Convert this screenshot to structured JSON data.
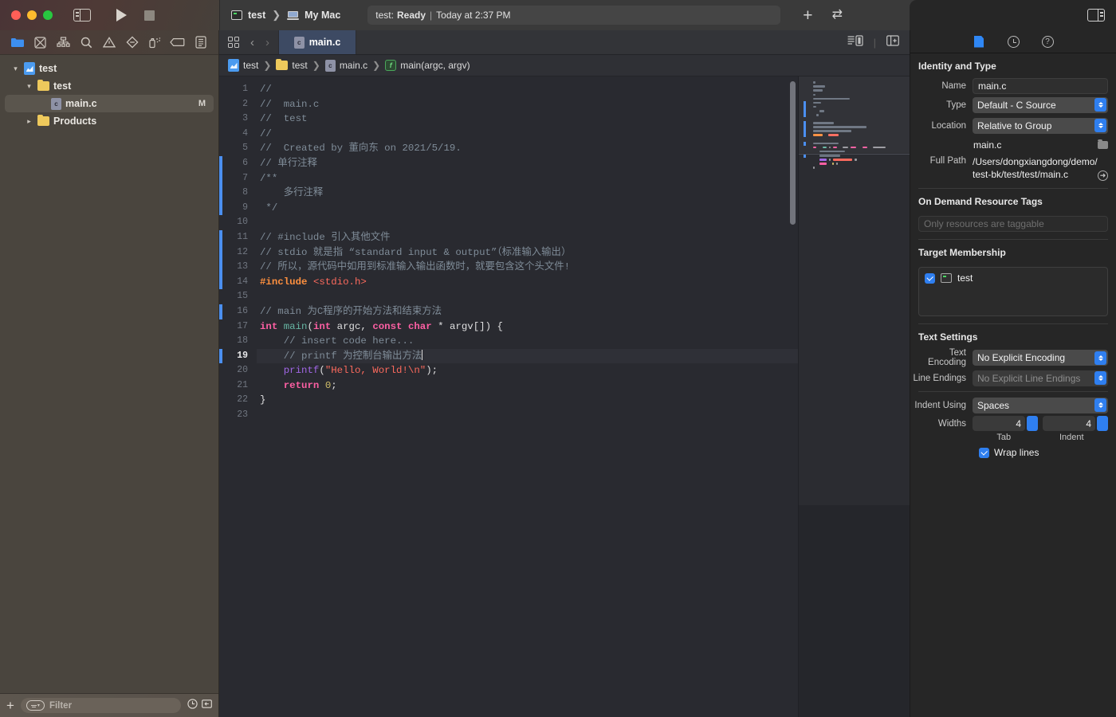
{
  "window": {
    "traffic_lights": [
      "close",
      "minimize",
      "zoom"
    ]
  },
  "toolbar": {
    "sidebar_toggle_name": "sidebar-toggle-icon",
    "run_label": "run-icon",
    "stop_label": "stop-icon",
    "scheme_name": "test",
    "destination": "My Mac",
    "activity_prefix": "test:",
    "activity_status": "Ready",
    "activity_separator": "|",
    "activity_time": "Today at 2:37 PM",
    "add_label": "+",
    "swap_label": "⇄",
    "inspector_toggle_name": "inspector-toggle-icon"
  },
  "navigator": {
    "tabs": [
      {
        "name": "project-navigator-tab",
        "icon": "folder-icon",
        "active": true
      },
      {
        "name": "source-control-navigator-tab",
        "icon": "source-control-icon",
        "active": false
      },
      {
        "name": "hierarchy-navigator-tab",
        "icon": "hierarchy-icon",
        "active": false
      },
      {
        "name": "find-navigator-tab",
        "icon": "search-icon",
        "active": false
      },
      {
        "name": "issue-navigator-tab",
        "icon": "warning-triangle-icon",
        "active": false
      },
      {
        "name": "test-navigator-tab",
        "icon": "diamond-icon",
        "active": false
      },
      {
        "name": "debug-navigator-tab",
        "icon": "spray-icon",
        "active": false
      },
      {
        "name": "breakpoint-navigator-tab",
        "icon": "tag-icon",
        "active": false
      },
      {
        "name": "report-navigator-tab",
        "icon": "report-icon",
        "active": false
      }
    ],
    "tree": [
      {
        "label": "test",
        "icon": "xcode-project-icon",
        "indent": 0,
        "disclosure": "open",
        "badge": "",
        "selected": false
      },
      {
        "label": "test",
        "icon": "folder-icon",
        "indent": 1,
        "disclosure": "open",
        "badge": "",
        "selected": false
      },
      {
        "label": "main.c",
        "icon": "c-file-icon",
        "indent": 2,
        "disclosure": "none",
        "badge": "M",
        "selected": true
      },
      {
        "label": "Products",
        "icon": "folder-icon",
        "indent": 1,
        "disclosure": "closed",
        "badge": "",
        "selected": false
      }
    ],
    "filter": {
      "add_label": "+",
      "placeholder": "Filter",
      "recent_icon": "clock-icon",
      "collapse_icon": "collapse-icon"
    }
  },
  "editor": {
    "tabbar": {
      "grid_icon": "tab-overview-icon",
      "back_label": "‹",
      "forward_label": "›",
      "tab_label": "main.c",
      "right_icons": [
        "editor-options-icon",
        "add-editor-icon"
      ]
    },
    "breadcrumb": [
      {
        "label": "test",
        "icon": "xcode-project-icon"
      },
      {
        "label": "test",
        "icon": "folder-icon"
      },
      {
        "label": "main.c",
        "icon": "c-file-icon"
      },
      {
        "label": "main(argc, argv)",
        "icon": "function-icon"
      }
    ],
    "current_line": 19,
    "changed_line_ranges": [
      [
        6,
        9
      ],
      [
        11,
        14
      ],
      [
        16,
        16
      ],
      [
        19,
        19
      ]
    ],
    "lines": [
      {
        "n": 1,
        "tokens": [
          {
            "t": "//",
            "c": "cmt"
          }
        ]
      },
      {
        "n": 2,
        "tokens": [
          {
            "t": "//  main.c",
            "c": "cmt"
          }
        ]
      },
      {
        "n": 3,
        "tokens": [
          {
            "t": "//  test",
            "c": "cmt"
          }
        ]
      },
      {
        "n": 4,
        "tokens": [
          {
            "t": "//",
            "c": "cmt"
          }
        ]
      },
      {
        "n": 5,
        "tokens": [
          {
            "t": "//  Created by 董向东 on 2021/5/19.",
            "c": "cmt"
          }
        ]
      },
      {
        "n": 6,
        "tokens": [
          {
            "t": "// 单行注释",
            "c": "cmt"
          }
        ]
      },
      {
        "n": 7,
        "tokens": [
          {
            "t": "/**",
            "c": "cmt"
          }
        ]
      },
      {
        "n": 8,
        "tokens": [
          {
            "t": "    多行注释",
            "c": "cmt"
          }
        ]
      },
      {
        "n": 9,
        "tokens": [
          {
            "t": " */",
            "c": "cmt"
          }
        ]
      },
      {
        "n": 10,
        "tokens": []
      },
      {
        "n": 11,
        "tokens": [
          {
            "t": "// #include 引入其他文件",
            "c": "cmt"
          }
        ]
      },
      {
        "n": 12,
        "tokens": [
          {
            "t": "// stdio 就是指 “standard input & output”（标准输入输出）",
            "c": "cmt"
          }
        ]
      },
      {
        "n": 13,
        "tokens": [
          {
            "t": "// 所以，源代码中如用到标准输入输出函数时，就要包含这个头文件!",
            "c": "cmt"
          }
        ]
      },
      {
        "n": 14,
        "tokens": [
          {
            "t": "#include",
            "c": "pp"
          },
          {
            "t": " ",
            "c": "plain"
          },
          {
            "t": "<stdio.h>",
            "c": "str"
          }
        ]
      },
      {
        "n": 15,
        "tokens": []
      },
      {
        "n": 16,
        "tokens": [
          {
            "t": "// main 为C程序的开始方法和结束方法",
            "c": "cmt"
          }
        ]
      },
      {
        "n": 17,
        "tokens": [
          {
            "t": "int",
            "c": "kw"
          },
          {
            "t": " ",
            "c": "plain"
          },
          {
            "t": "main",
            "c": "fn"
          },
          {
            "t": "(",
            "c": "plain"
          },
          {
            "t": "int",
            "c": "kw"
          },
          {
            "t": " argc, ",
            "c": "plain"
          },
          {
            "t": "const",
            "c": "kw"
          },
          {
            "t": " ",
            "c": "plain"
          },
          {
            "t": "char",
            "c": "kw"
          },
          {
            "t": " * argv[]) {",
            "c": "plain"
          }
        ]
      },
      {
        "n": 18,
        "tokens": [
          {
            "t": "    // insert code here...",
            "c": "cmt"
          }
        ]
      },
      {
        "n": 19,
        "tokens": [
          {
            "t": "    // printf 为控制台输出方法",
            "c": "cmt"
          }
        ],
        "caret": true
      },
      {
        "n": 20,
        "tokens": [
          {
            "t": "    ",
            "c": "plain"
          },
          {
            "t": "printf",
            "c": "fnp"
          },
          {
            "t": "(",
            "c": "plain"
          },
          {
            "t": "\"Hello, World!\\n\"",
            "c": "str"
          },
          {
            "t": ");",
            "c": "plain"
          }
        ]
      },
      {
        "n": 21,
        "tokens": [
          {
            "t": "    ",
            "c": "plain"
          },
          {
            "t": "return",
            "c": "kw"
          },
          {
            "t": " ",
            "c": "plain"
          },
          {
            "t": "0",
            "c": "num"
          },
          {
            "t": ";",
            "c": "plain"
          }
        ]
      },
      {
        "n": 22,
        "tokens": [
          {
            "t": "}",
            "c": "plain"
          }
        ]
      },
      {
        "n": 23,
        "tokens": []
      }
    ]
  },
  "inspector": {
    "tabs": [
      {
        "name": "file-inspector-tab",
        "icon": "document-icon",
        "active": true
      },
      {
        "name": "history-inspector-tab",
        "icon": "clock-icon",
        "active": false
      },
      {
        "name": "quick-help-inspector-tab",
        "icon": "help-circle-icon",
        "active": false
      }
    ],
    "identity_and_type": {
      "title": "Identity and Type",
      "name_label": "Name",
      "name_value": "main.c",
      "type_label": "Type",
      "type_value": "Default - C Source",
      "location_label": "Location",
      "location_value": "Relative to Group",
      "location_file": "main.c",
      "full_path_label": "Full Path",
      "full_path_value": "/Users/dongxiangdong/demo/test-bk/test/test/main.c"
    },
    "on_demand_resource_tags": {
      "title": "On Demand Resource Tags",
      "placeholder": "Only resources are taggable"
    },
    "target_membership": {
      "title": "Target Membership",
      "items": [
        {
          "label": "test",
          "checked": true
        }
      ]
    },
    "text_settings": {
      "title": "Text Settings",
      "text_encoding_label": "Text Encoding",
      "text_encoding_value": "No Explicit Encoding",
      "line_endings_label": "Line Endings",
      "line_endings_value": "No Explicit Line Endings",
      "line_endings_disabled": true,
      "indent_using_label": "Indent Using",
      "indent_using_value": "Spaces",
      "widths_label": "Widths",
      "tab_width": "4",
      "indent_width": "4",
      "tab_sublabel": "Tab",
      "indent_sublabel": "Indent",
      "wrap_lines_label": "Wrap lines",
      "wrap_lines_checked": true
    }
  },
  "colors": {
    "accent_blue": "#2f7ff0",
    "editor_bg": "#292a30",
    "navigator_bg": "#4a453e",
    "inspector_bg": "#262626",
    "active_tab_bg": "#3d4a63",
    "comment": "#7f8c98",
    "keyword": "#fc5fa3",
    "preprocessor": "#fd8f3f",
    "string": "#fc6a5d",
    "function_call": "#a167e6",
    "function_decl": "#67b7a4",
    "number": "#d0bf69",
    "change_bar": "#4b8ff0"
  }
}
